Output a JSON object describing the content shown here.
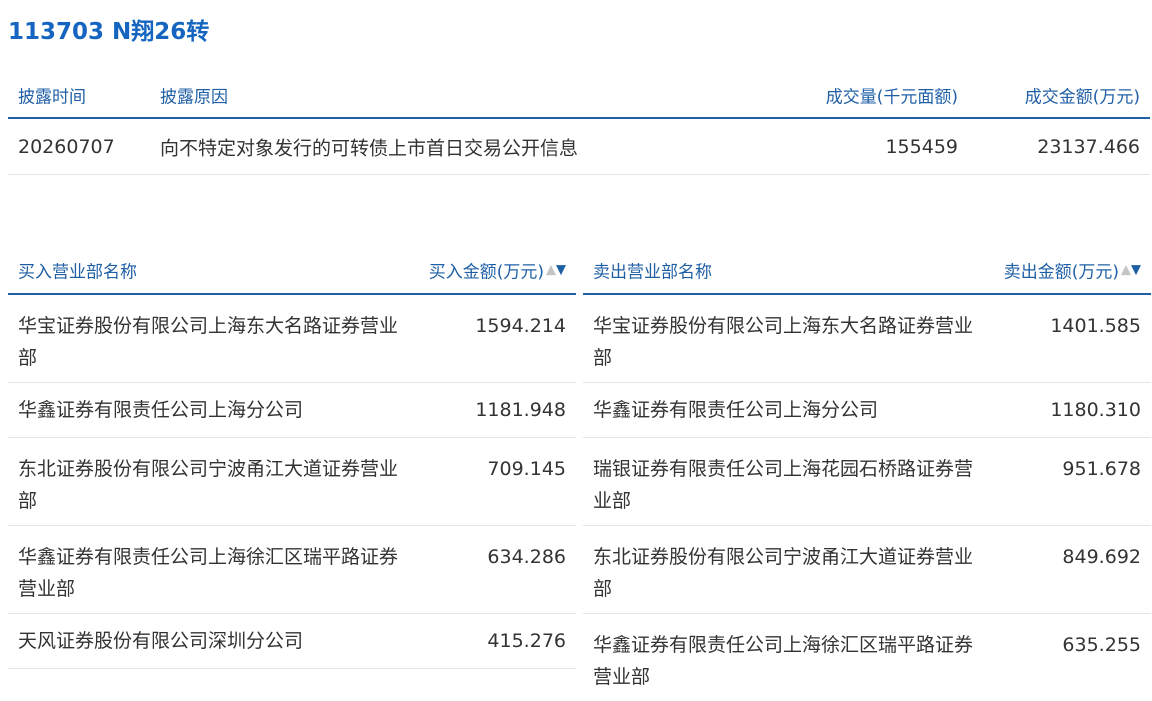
{
  "title": "113703 N翔26转",
  "disclosure": {
    "headers": [
      "披露时间",
      "披露原因",
      "成交量(千元面额)",
      "成交金额(万元)"
    ],
    "row": {
      "date": "20260707",
      "reason": "向不特定对象发行的可转债上市首日交易公开信息",
      "volume": "155459",
      "amount": "23137.466"
    }
  },
  "buy": {
    "name_header": "买入营业部名称",
    "amount_header": "买入金额(万元)",
    "sort_up": "▲",
    "sort_down": "▼",
    "rows": [
      {
        "name": "华宝证券股份有限公司上海东大名路证券营业部",
        "amount": "1594.214"
      },
      {
        "name": "华鑫证券有限责任公司上海分公司",
        "amount": "1181.948"
      },
      {
        "name": "东北证券股份有限公司宁波甬江大道证券营业部",
        "amount": "709.145"
      },
      {
        "name": "华鑫证券有限责任公司上海徐汇区瑞平路证券营业部",
        "amount": "634.286"
      },
      {
        "name": "天风证券股份有限公司深圳分公司",
        "amount": "415.276"
      }
    ]
  },
  "sell": {
    "name_header": "卖出营业部名称",
    "amount_header": "卖出金额(万元)",
    "sort_up": "▲",
    "sort_down": "▼",
    "rows": [
      {
        "name": "华宝证券股份有限公司上海东大名路证券营业部",
        "amount": "1401.585"
      },
      {
        "name": "华鑫证券有限责任公司上海分公司",
        "amount": "1180.310"
      },
      {
        "name": "瑞银证券有限责任公司上海花园石桥路证券营业部",
        "amount": "951.678"
      },
      {
        "name": "东北证券股份有限公司宁波甬江大道证券营业部",
        "amount": "849.692"
      },
      {
        "name": "华鑫证券有限责任公司上海徐汇区瑞平路证券营业部",
        "amount": "635.255"
      }
    ]
  },
  "colors": {
    "accent": "#1f5fa6",
    "title": "#1565c0",
    "text": "#333333",
    "divider": "#e5e5e5",
    "sort_inactive": "#c4c4c4"
  }
}
